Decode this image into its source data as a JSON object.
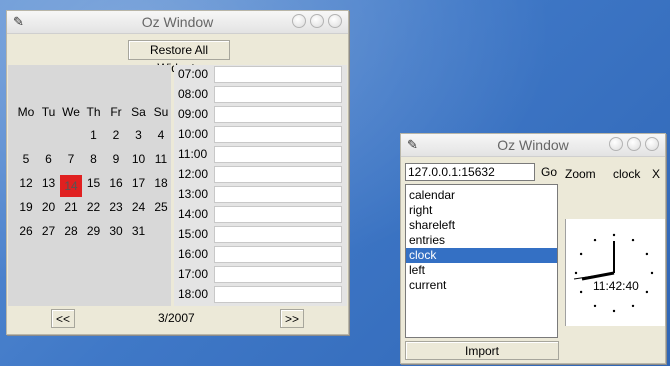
{
  "left_window": {
    "title": "Oz Window",
    "restore_label": "Restore All Widgets",
    "weekdays": [
      "Mo",
      "Tu",
      "We",
      "Th",
      "Fr",
      "Sa",
      "Su"
    ],
    "weeks": [
      [
        "",
        "",
        "",
        "1",
        "2",
        "3",
        "4"
      ],
      [
        "5",
        "6",
        "7",
        "8",
        "9",
        "10",
        "11"
      ],
      [
        "12",
        "13",
        "14",
        "15",
        "16",
        "17",
        "18"
      ],
      [
        "19",
        "20",
        "21",
        "22",
        "23",
        "24",
        "25"
      ],
      [
        "26",
        "27",
        "28",
        "29",
        "30",
        "31",
        ""
      ]
    ],
    "selected_day": "14",
    "selected_color": "#e02020",
    "times": [
      "07:00",
      "08:00",
      "09:00",
      "10:00",
      "11:00",
      "12:00",
      "13:00",
      "14:00",
      "15:00",
      "16:00",
      "17:00",
      "18:00"
    ],
    "prev_label": "<<",
    "next_label": ">>",
    "month_label": "3/2007"
  },
  "right_window": {
    "title": "Oz Window",
    "address_value": "127.0.0.1:15632",
    "go_label": "Go",
    "zoom_label": "Zoom",
    "component_label": "clock",
    "close_label": "X",
    "items": [
      "calendar",
      "right",
      "shareleft",
      "entries",
      "clock",
      "left",
      "current"
    ],
    "selected_item": "clock",
    "selection_color": "#3470c4",
    "import_label": "Import",
    "clock_time": "11:42:40"
  },
  "icons": {
    "window_icon": "feather-icon",
    "title_buttons": [
      "minimize-icon",
      "maximize-icon",
      "close-icon"
    ]
  }
}
